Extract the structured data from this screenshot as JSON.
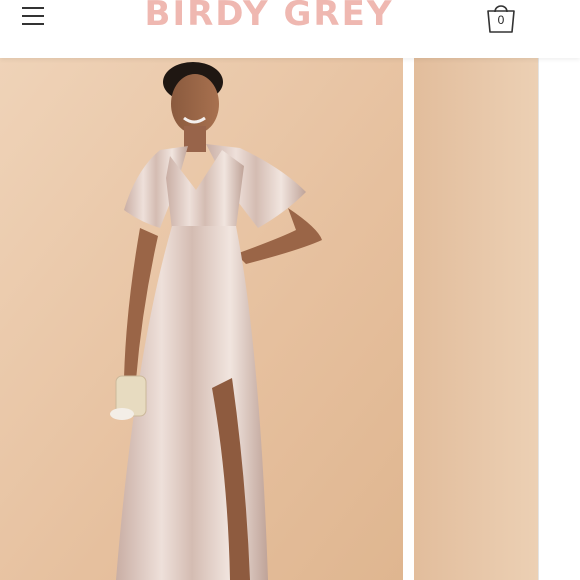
{
  "header": {
    "brand": "BIRDY GREY",
    "menu_icon": "hamburger-menu-icon",
    "cart_icon": "shopping-bag-icon",
    "cart_count": "0"
  },
  "colors": {
    "brand": "#efb8b1",
    "backdrop": "#e8c3a2",
    "dress": "#d9c1b9"
  },
  "gallery": {
    "images": [
      {
        "description_icon": "model-in-satin-dress-photo"
      },
      {
        "description_icon": "product-photo"
      }
    ]
  }
}
